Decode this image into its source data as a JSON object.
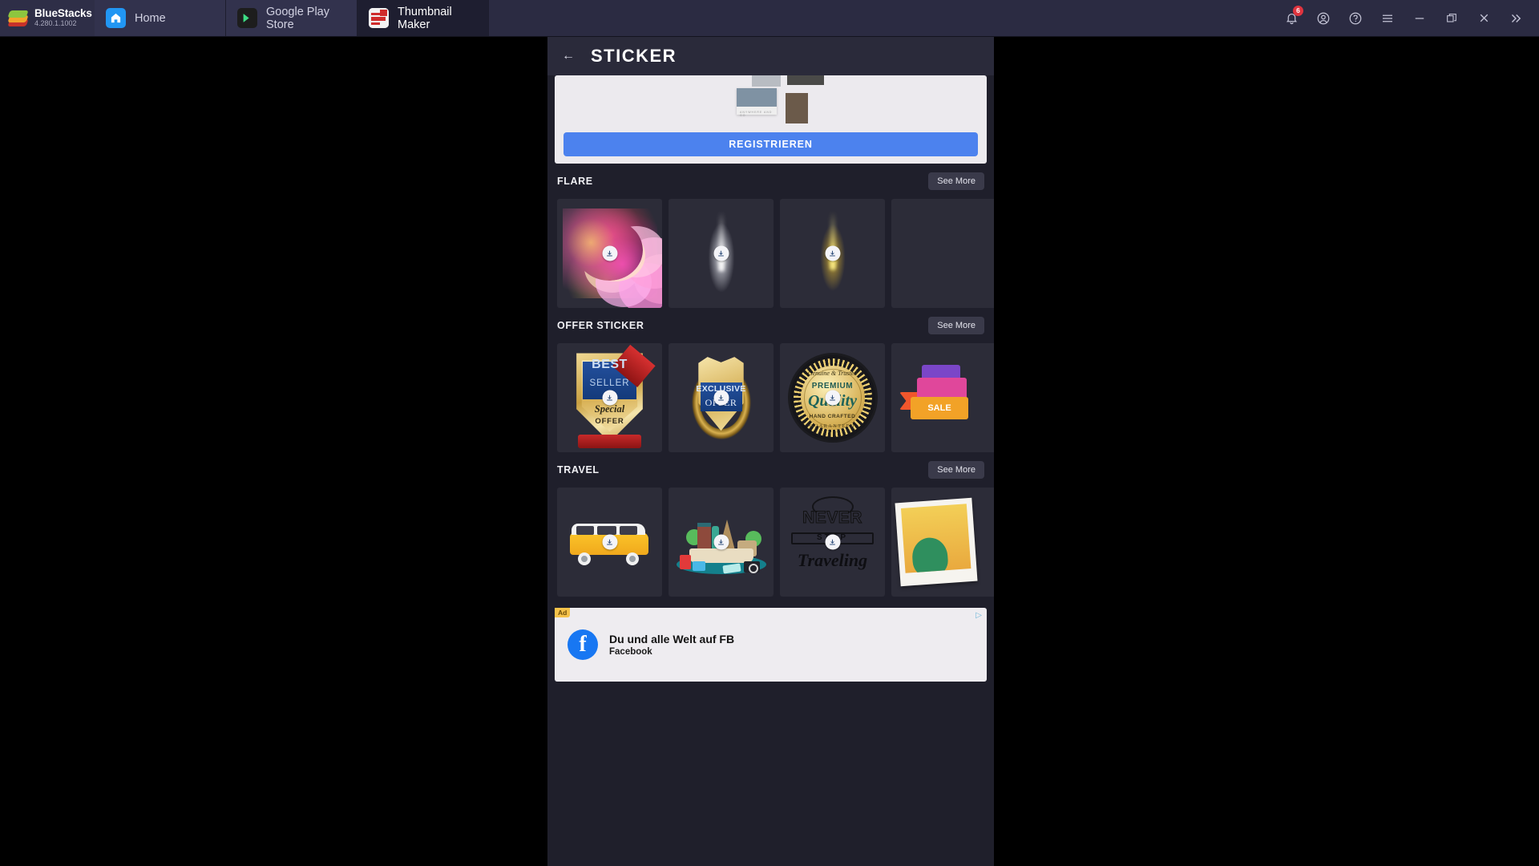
{
  "bluestacks": {
    "brand": "BlueStacks",
    "version": "4.280.1.1002",
    "tabs": [
      {
        "label": "Home",
        "icon": "home-icon",
        "active": false
      },
      {
        "label": "Google Play Store",
        "icon": "google-play-icon",
        "active": false
      },
      {
        "label": "Thumbnail Maker",
        "icon": "thumbnail-maker-icon",
        "active": true
      }
    ],
    "actions": [
      {
        "name": "notifications-icon",
        "badge": "6"
      },
      {
        "name": "account-icon",
        "badge": ""
      },
      {
        "name": "help-icon",
        "badge": ""
      },
      {
        "name": "menu-icon",
        "badge": ""
      },
      {
        "name": "minimize-icon",
        "badge": ""
      },
      {
        "name": "maximize-icon",
        "badge": ""
      },
      {
        "name": "close-icon",
        "badge": ""
      },
      {
        "name": "expand-sidebar-icon",
        "badge": ""
      }
    ]
  },
  "app": {
    "title": "STICKER",
    "back_label": "←",
    "promo": {
      "register_label": "REGISTRIEREN",
      "caption": "ANYWHERE AND GO"
    },
    "sections": [
      {
        "title": "FLARE",
        "see_more": "See More",
        "items": [
          {
            "name": "heart-fireworks-flare-sticker",
            "download": "download-icon"
          },
          {
            "name": "white-light-flare-sticker",
            "download": "download-icon"
          },
          {
            "name": "gold-light-flare-sticker",
            "download": "download-icon"
          },
          {
            "name": "flare-sticker-partial",
            "download": ""
          }
        ]
      },
      {
        "title": "OFFER STICKER",
        "see_more": "See More",
        "items": [
          {
            "name": "best-seller-special-offer-sticker",
            "download": "download-icon",
            "text": {
              "l1": "BEST",
              "l2": "SELLER",
              "l3": "Special",
              "l4": "OFFER"
            }
          },
          {
            "name": "exclusive-offer-sticker",
            "download": "download-icon",
            "text": {
              "l1": "EXCLUSIVE",
              "l2": "OFFER"
            }
          },
          {
            "name": "premium-quality-sticker",
            "download": "download-icon",
            "text": {
              "l1": "Genuine & Trusted",
              "l2": "PREMIUM",
              "l3": "Quality",
              "l4": "HAND CRAFTED",
              "l5": "GUARANTEED"
            }
          },
          {
            "name": "sale-tags-sticker",
            "download": "",
            "text": {
              "l1": "SALE"
            }
          }
        ]
      },
      {
        "title": "TRAVEL",
        "see_more": "See More",
        "items": [
          {
            "name": "yellow-van-sticker",
            "download": "download-icon"
          },
          {
            "name": "world-landmarks-sticker",
            "download": "download-icon"
          },
          {
            "name": "never-stop-traveling-sticker",
            "download": "download-icon",
            "text": {
              "l1": "NEVER",
              "l2": "STOP",
              "l3": "Traveling"
            }
          },
          {
            "name": "polaroid-photo-sticker",
            "download": ""
          }
        ]
      }
    ],
    "ad": {
      "tag": "Ad",
      "close": "▷",
      "headline": "Du und alle Welt auf FB",
      "advertiser": "Facebook",
      "icon": "facebook-icon"
    }
  },
  "colors": {
    "accent_blue": "#4c82ee",
    "chrome_bg": "#2b2b42",
    "app_bg": "#1f1f2b",
    "card_bg": "#2c2c38"
  }
}
